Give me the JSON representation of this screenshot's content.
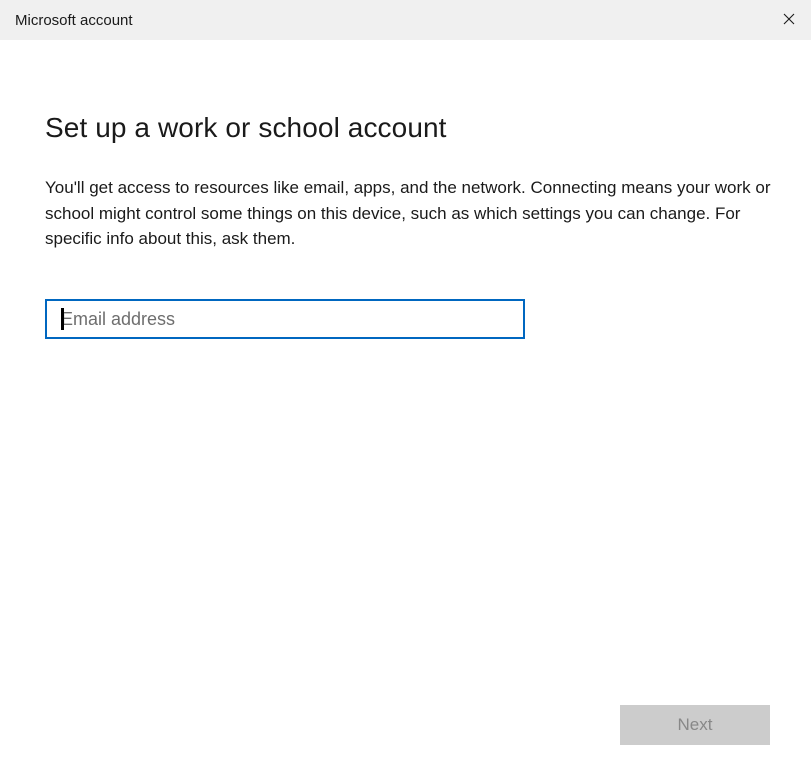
{
  "window": {
    "title": "Microsoft account"
  },
  "main": {
    "heading": "Set up a work or school account",
    "description": "You'll get access to resources like email, apps, and the network. Connecting means your work or school might control some things on this device, such as which settings you can change. For specific info about this, ask them.",
    "email": {
      "value": "",
      "placeholder": "Email address"
    }
  },
  "footer": {
    "next_label": "Next",
    "next_enabled": false
  },
  "icons": {
    "close": "close-icon"
  },
  "colors": {
    "titlebar_bg": "#f0f0f0",
    "accent_border": "#0067c0",
    "disabled_button_bg": "#cccccc",
    "disabled_button_text": "#888888"
  }
}
